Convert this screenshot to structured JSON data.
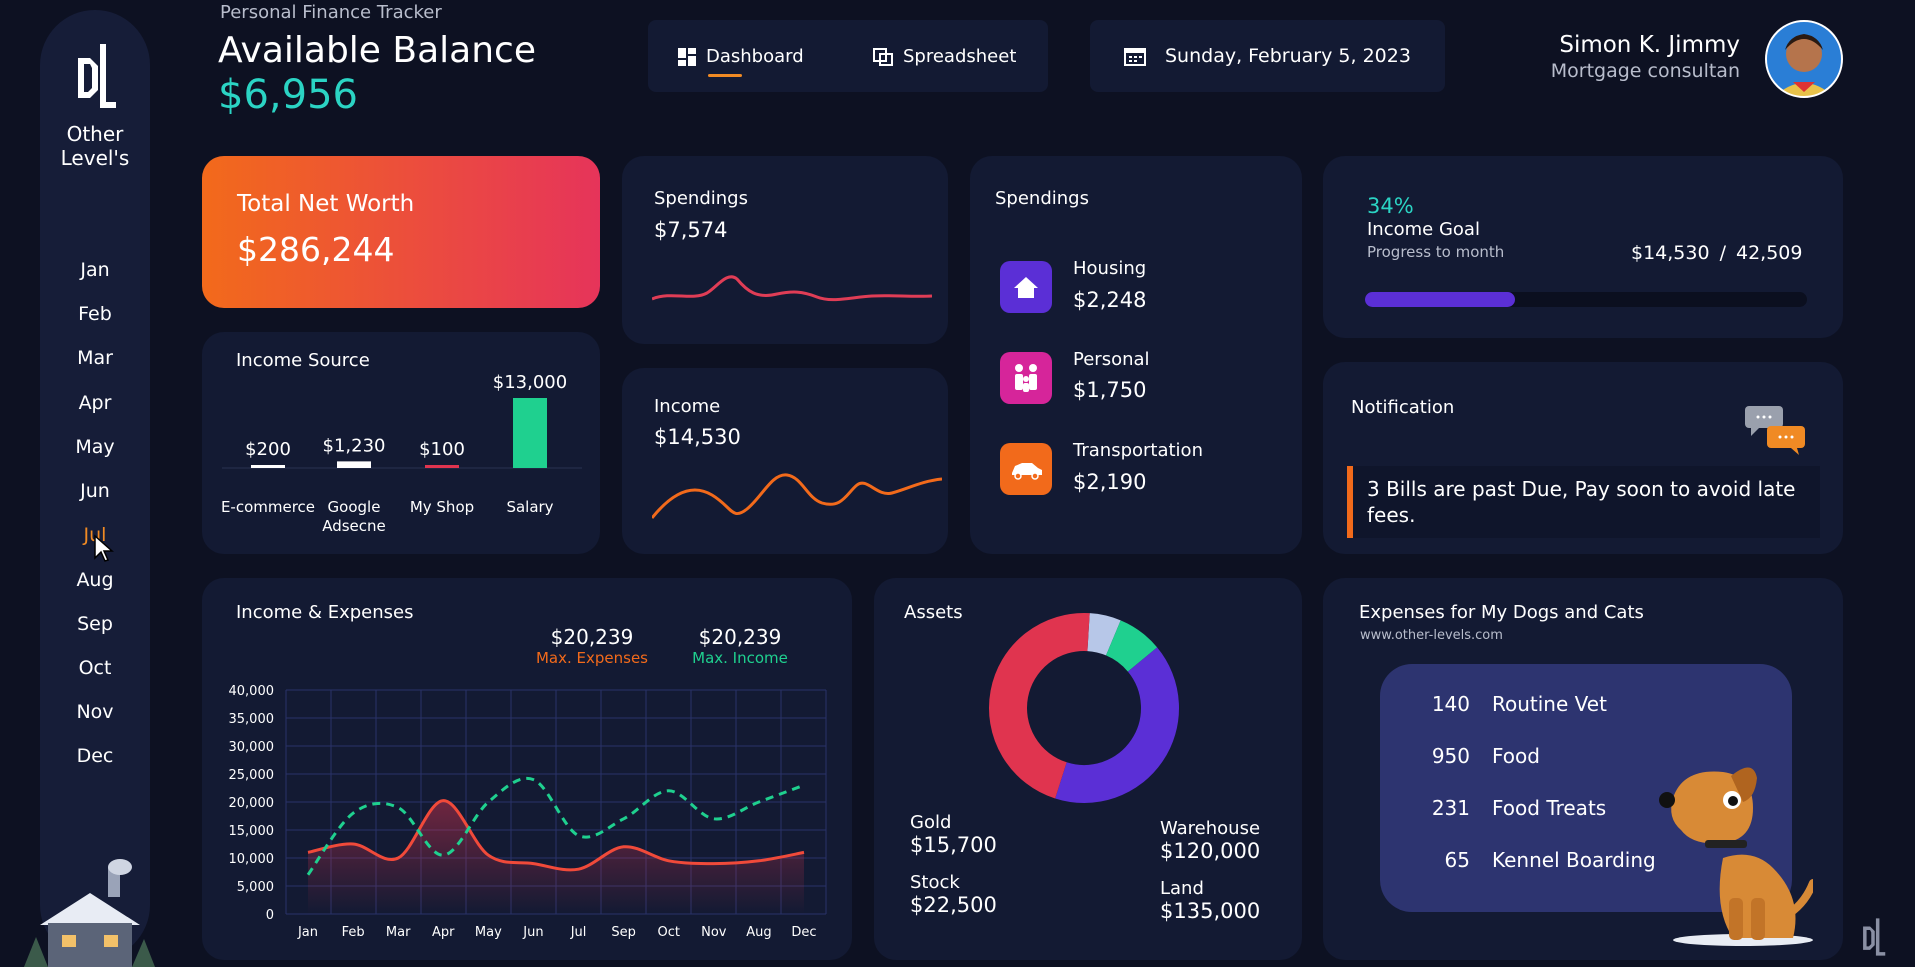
{
  "app": {
    "subtitle": "Personal Finance Tracker",
    "balance_label": "Available Balance",
    "balance_value": "$6,956",
    "logo_text_1": "Other",
    "logo_text_2": "Level's",
    "watermark": "www.other-levels.com"
  },
  "nav": {
    "dashboard": "Dashboard",
    "spreadsheet": "Spreadsheet",
    "date": "Sunday, February 5, 2023"
  },
  "user": {
    "name": "Simon K. Jimmy",
    "role": "Mortgage consultan"
  },
  "months": [
    "Jan",
    "Feb",
    "Mar",
    "Apr",
    "May",
    "Jun",
    "Jul",
    "Aug",
    "Sep",
    "Oct",
    "Nov",
    "Dec"
  ],
  "active_month": "Jul",
  "net_worth": {
    "label": "Total Net Worth",
    "value": "$286,244"
  },
  "spendings_card": {
    "label": "Spendings",
    "value": "$7,574"
  },
  "income_card": {
    "label": "Income",
    "value": "$14,530"
  },
  "spendings_list": {
    "title": "Spendings",
    "items": [
      {
        "label": "Housing",
        "value": "$2,248"
      },
      {
        "label": "Personal",
        "value": "$1,750"
      },
      {
        "label": "Transportation",
        "value": "$2,190"
      }
    ]
  },
  "income_goal": {
    "percent": "34%",
    "title": "Income Goal",
    "subtitle": "Progress to month",
    "current": "$14,530",
    "separator": "/",
    "target": "42,509",
    "progress": 0.34
  },
  "notification": {
    "title": "Notification",
    "message": "3 Bills are past Due, Pay soon to avoid late fees."
  },
  "income_source": {
    "title": "Income Source",
    "bars": [
      {
        "label": "E-commerce",
        "value": "$200"
      },
      {
        "label": "Google\nAdsecne",
        "value": "$1,230"
      },
      {
        "label": "My Shop",
        "value": "$100"
      },
      {
        "label": "Salary",
        "value": "$13,000"
      }
    ]
  },
  "income_expenses": {
    "title": "Income & Expenses",
    "max_expenses_value": "$20,239",
    "max_expenses_label": "Max. Expenses",
    "max_income_value": "$20,239",
    "max_income_label": "Max. Income"
  },
  "assets": {
    "title": "Assets",
    "items": [
      {
        "label": "Gold",
        "value": "$15,700"
      },
      {
        "label": "Stock",
        "value": "$22,500"
      },
      {
        "label": "Warehouse",
        "value": "$120,000"
      },
      {
        "label": "Land",
        "value": "$135,000"
      }
    ]
  },
  "pets": {
    "title": "Expenses for My Dogs and Cats",
    "url": "www.other-levels.com",
    "items": [
      {
        "amount": "140",
        "label": "Routine Vet"
      },
      {
        "amount": "950",
        "label": "Food"
      },
      {
        "amount": "231",
        "label": "Food Treats"
      },
      {
        "amount": "65",
        "label": "Kennel Boarding"
      }
    ]
  },
  "colors": {
    "accent": "#f08a24",
    "teal": "#2bd4c4",
    "green": "#1fd08f",
    "purple": "#5b2fd6",
    "red": "#e0344f",
    "bg": "#0d1122",
    "card": "#131a33"
  },
  "chart_data": [
    {
      "type": "bar",
      "title": "Income Source",
      "categories": [
        "E-commerce",
        "Google Adsecne",
        "My Shop",
        "Salary"
      ],
      "values": [
        200,
        1230,
        100,
        13000
      ]
    },
    {
      "type": "line",
      "title": "Income & Expenses",
      "categories": [
        "Jan",
        "Feb",
        "Mar",
        "Apr",
        "May",
        "Jun",
        "Jul",
        "Sep",
        "Oct",
        "Nov",
        "Aug",
        "Dec"
      ],
      "ylim": [
        0,
        40000
      ],
      "yticks": [
        0,
        5000,
        10000,
        15000,
        20000,
        25000,
        30000,
        35000,
        40000
      ],
      "ytick_labels": [
        "0",
        "5,000",
        "10,000",
        "15,000",
        "20,000",
        "25,000",
        "30,000",
        "35,000",
        "40,000"
      ],
      "series": [
        {
          "name": "Max. Expenses",
          "values": [
            11000,
            12500,
            10000,
            20239,
            10500,
            9000,
            8000,
            12000,
            9500,
            9000,
            9500,
            11000
          ]
        },
        {
          "name": "Max. Income",
          "values": [
            7000,
            18000,
            19000,
            10500,
            20000,
            24000,
            14000,
            17000,
            22000,
            17000,
            20000,
            23000
          ]
        }
      ]
    },
    {
      "type": "pie",
      "title": "Assets",
      "categories": [
        "Gold",
        "Stock",
        "Warehouse",
        "Land"
      ],
      "values": [
        15700,
        22500,
        120000,
        135000
      ]
    }
  ]
}
